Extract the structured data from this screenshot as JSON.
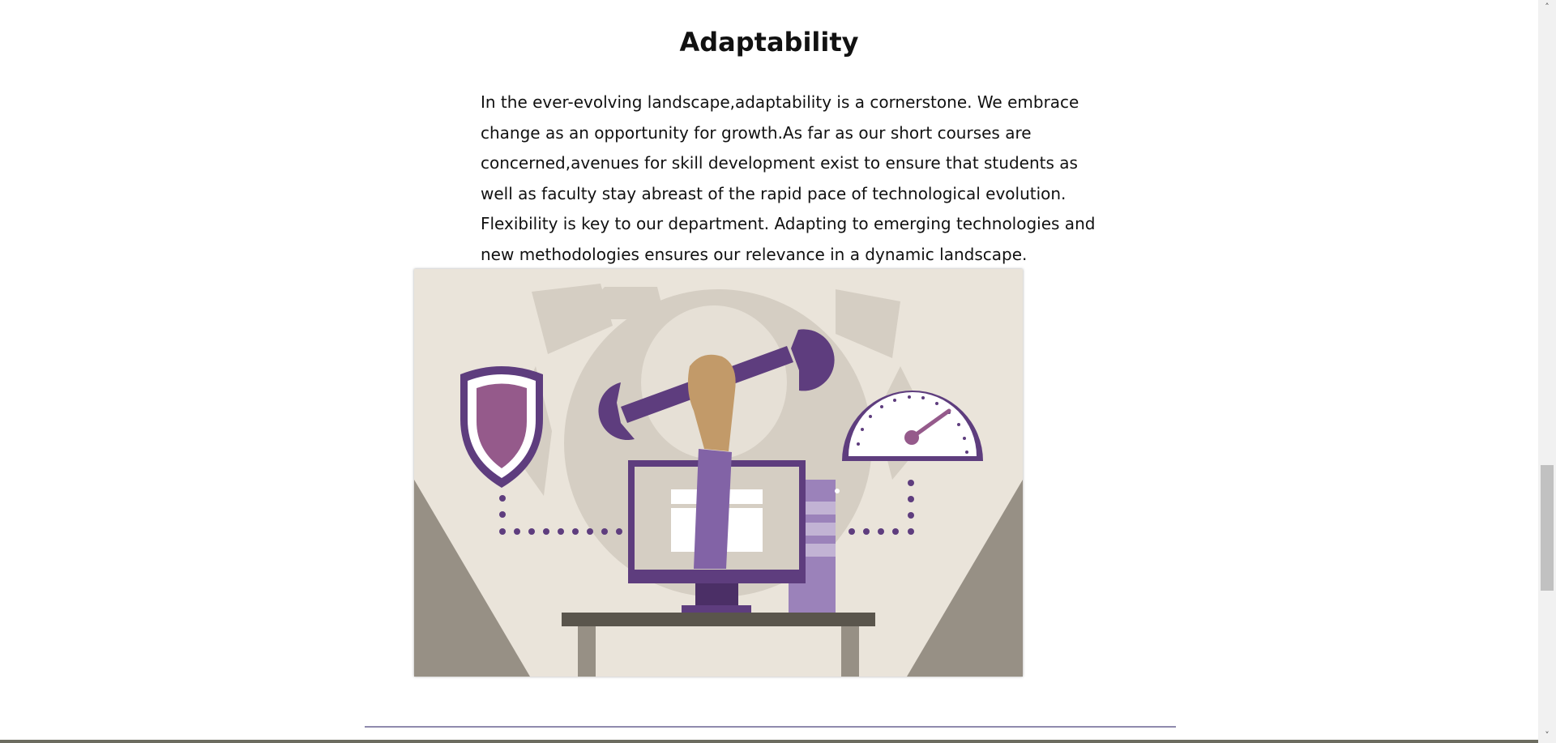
{
  "section": {
    "heading": "Adaptability",
    "paragraph": "In the ever-evolving landscape,adaptability is a cornerstone. We embrace change as an opportunity for growth.As far as our short courses are concerned,avenues for skill development exist to ensure that students as well as faculty stay abreast of the rapid pace of technological evolution. Flexibility is key to our department. Adapting to emerging technologies and new methodologies ensures our relevance in a dynamic landscape."
  },
  "illustration": {
    "icons": [
      "shield-icon",
      "wrench-icon",
      "computer-monitor-icon",
      "gauge-icon",
      "gear-icon"
    ],
    "colors": {
      "background": "#eae4da",
      "gear": "#d5cec3",
      "purple": "#5e3d7e",
      "purple_light": "#9b82ba",
      "shield_fill": "#955a8b",
      "skin": "#c29a69",
      "desk": "#5a554c",
      "side_wedges": "#979085"
    }
  },
  "scrollbar": {
    "up_arrow": "˄",
    "down_arrow": "˅"
  }
}
